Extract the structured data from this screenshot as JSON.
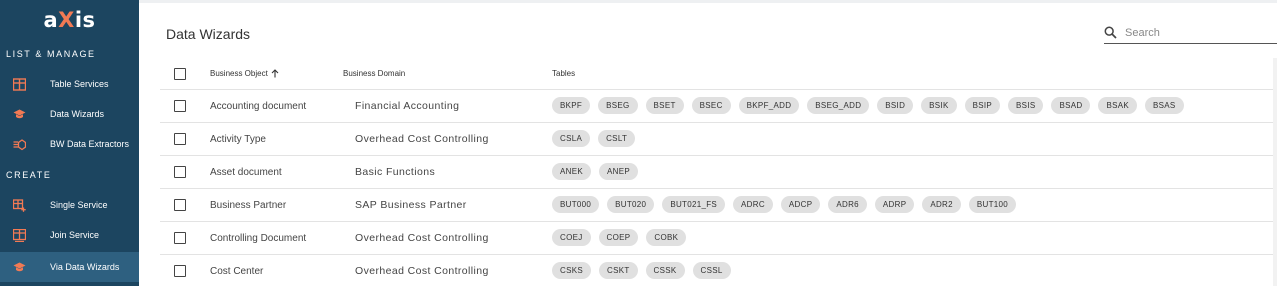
{
  "app": {
    "logo_text_a": "a",
    "logo_text_x": "X",
    "logo_text_rest": "is",
    "accent_color": "#f27a54"
  },
  "sidebar": {
    "sections": [
      {
        "label": "LIST & MANAGE"
      },
      {
        "label": "CREATE"
      }
    ],
    "items": [
      {
        "label": "Table Services",
        "icon": "table-icon"
      },
      {
        "label": "Data Wizards",
        "icon": "graduation-cap-icon"
      },
      {
        "label": "BW Data Extractors",
        "icon": "extractor-icon"
      },
      {
        "label": "Single Service",
        "icon": "table-add-icon"
      },
      {
        "label": "Join Service",
        "icon": "join-table-icon"
      },
      {
        "label": "Via Data Wizards",
        "icon": "graduation-cap-icon",
        "active": true
      }
    ]
  },
  "main": {
    "title": "Data Wizards",
    "search": {
      "placeholder": "Search",
      "icon": "search-icon"
    },
    "columns": {
      "object": "Business Object",
      "domain": "Business Domain",
      "tables": "Tables"
    },
    "sort_icon": "arrow-up-icon",
    "rows": [
      {
        "object": "Accounting document",
        "domain": "Financial Accounting",
        "tables": [
          "BKPF",
          "BSEG",
          "BSET",
          "BSEC",
          "BKPF_ADD",
          "BSEG_ADD",
          "BSID",
          "BSIK",
          "BSIP",
          "BSIS",
          "BSAD",
          "BSAK",
          "BSAS"
        ]
      },
      {
        "object": "Activity Type",
        "domain": "Overhead Cost Controlling",
        "tables": [
          "CSLA",
          "CSLT"
        ]
      },
      {
        "object": "Asset document",
        "domain": "Basic Functions",
        "tables": [
          "ANEK",
          "ANEP"
        ]
      },
      {
        "object": "Business Partner",
        "domain": "SAP Business Partner",
        "tables": [
          "BUT000",
          "BUT020",
          "BUT021_FS",
          "ADRC",
          "ADCP",
          "ADR6",
          "ADRP",
          "ADR2",
          "BUT100"
        ]
      },
      {
        "object": "Controlling Document",
        "domain": "Overhead Cost Controlling",
        "tables": [
          "COEJ",
          "COEP",
          "COBK"
        ]
      },
      {
        "object": "Cost Center",
        "domain": "Overhead Cost Controlling",
        "tables": [
          "CSKS",
          "CSKT",
          "CSSK",
          "CSSL"
        ]
      }
    ]
  }
}
